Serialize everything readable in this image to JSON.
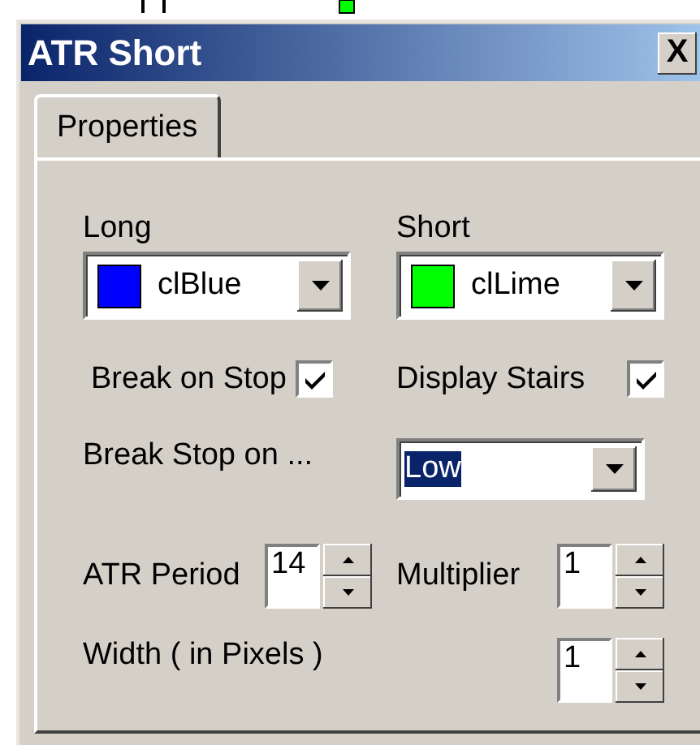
{
  "window": {
    "title": "ATR Short",
    "close_label": "X"
  },
  "tabs": [
    {
      "label": "Properties",
      "selected": true
    }
  ],
  "rows": [
    {
      "cells": [
        {
          "kind": "label",
          "label": "Long"
        },
        {
          "kind": "label",
          "label": "Short"
        }
      ]
    },
    {
      "cells": [
        {
          "kind": "color_combo",
          "value": "clBlue",
          "color": "#0000ff"
        },
        {
          "kind": "color_combo",
          "value": "clLime",
          "color": "#00ff00"
        }
      ]
    },
    {
      "cells": [
        {
          "kind": "checkbox",
          "label": "Break on Stop",
          "checked": true
        },
        {
          "kind": "checkbox",
          "label": "Display Stairs",
          "checked": true
        }
      ]
    },
    {
      "cells": [
        {
          "kind": "label",
          "label": "Break Stop on ..."
        },
        {
          "kind": "combo",
          "value": "Low",
          "highlighted": true
        }
      ]
    },
    {
      "cells": [
        {
          "kind": "spin",
          "label": "ATR Period",
          "value": "14"
        },
        {
          "kind": "spin",
          "label": "Multiplier",
          "value": "1"
        }
      ]
    },
    {
      "cells": [
        {
          "kind": "label",
          "label": "Width ( in Pixels )"
        },
        {
          "kind": "spin",
          "value": "1"
        }
      ]
    }
  ]
}
